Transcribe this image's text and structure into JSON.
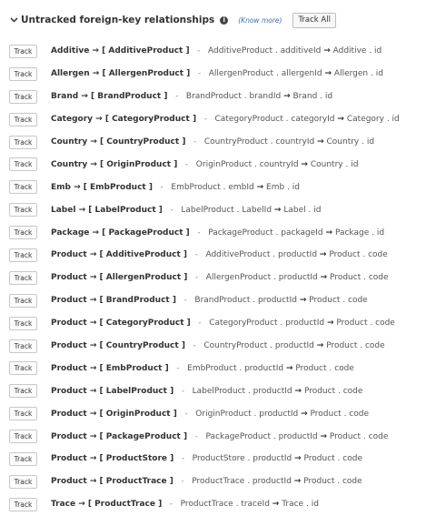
{
  "header": {
    "title": "Untracked foreign-key relationships",
    "know_more": "(Know more)",
    "track_all": "Track All"
  },
  "track_label": "Track",
  "rows": [
    {
      "source": "Additive",
      "target": "AdditiveProduct",
      "join_table": "AdditiveProduct",
      "join_col": "additiveId",
      "ref_table": "Additive",
      "ref_col": "id"
    },
    {
      "source": "Allergen",
      "target": "AllergenProduct",
      "join_table": "AllergenProduct",
      "join_col": "allergenId",
      "ref_table": "Allergen",
      "ref_col": "id"
    },
    {
      "source": "Brand",
      "target": "BrandProduct",
      "join_table": "BrandProduct",
      "join_col": "brandId",
      "ref_table": "Brand",
      "ref_col": "id"
    },
    {
      "source": "Category",
      "target": "CategoryProduct",
      "join_table": "CategoryProduct",
      "join_col": "categoryId",
      "ref_table": "Category",
      "ref_col": "id"
    },
    {
      "source": "Country",
      "target": "CountryProduct",
      "join_table": "CountryProduct",
      "join_col": "countryId",
      "ref_table": "Country",
      "ref_col": "id"
    },
    {
      "source": "Country",
      "target": "OriginProduct",
      "join_table": "OriginProduct",
      "join_col": "countryId",
      "ref_table": "Country",
      "ref_col": "id"
    },
    {
      "source": "Emb",
      "target": "EmbProduct",
      "join_table": "EmbProduct",
      "join_col": "embId",
      "ref_table": "Emb",
      "ref_col": "id"
    },
    {
      "source": "Label",
      "target": "LabelProduct",
      "join_table": "LabelProduct",
      "join_col": "LabelId",
      "ref_table": "Label",
      "ref_col": "id"
    },
    {
      "source": "Package",
      "target": "PackageProduct",
      "join_table": "PackageProduct",
      "join_col": "packageId",
      "ref_table": "Package",
      "ref_col": "id"
    },
    {
      "source": "Product",
      "target": "AdditiveProduct",
      "join_table": "AdditiveProduct",
      "join_col": "productId",
      "ref_table": "Product",
      "ref_col": "code"
    },
    {
      "source": "Product",
      "target": "AllergenProduct",
      "join_table": "AllergenProduct",
      "join_col": "productId",
      "ref_table": "Product",
      "ref_col": "code"
    },
    {
      "source": "Product",
      "target": "BrandProduct",
      "join_table": "BrandProduct",
      "join_col": "productId",
      "ref_table": "Product",
      "ref_col": "code"
    },
    {
      "source": "Product",
      "target": "CategoryProduct",
      "join_table": "CategoryProduct",
      "join_col": "productId",
      "ref_table": "Product",
      "ref_col": "code"
    },
    {
      "source": "Product",
      "target": "CountryProduct",
      "join_table": "CountryProduct",
      "join_col": "productId",
      "ref_table": "Product",
      "ref_col": "code"
    },
    {
      "source": "Product",
      "target": "EmbProduct",
      "join_table": "EmbProduct",
      "join_col": "productId",
      "ref_table": "Product",
      "ref_col": "code"
    },
    {
      "source": "Product",
      "target": "LabelProduct",
      "join_table": "LabelProduct",
      "join_col": "productId",
      "ref_table": "Product",
      "ref_col": "code"
    },
    {
      "source": "Product",
      "target": "OriginProduct",
      "join_table": "OriginProduct",
      "join_col": "productId",
      "ref_table": "Product",
      "ref_col": "code"
    },
    {
      "source": "Product",
      "target": "PackageProduct",
      "join_table": "PackageProduct",
      "join_col": "productId",
      "ref_table": "Product",
      "ref_col": "code"
    },
    {
      "source": "Product",
      "target": "ProductStore",
      "join_table": "ProductStore",
      "join_col": "productId",
      "ref_table": "Product",
      "ref_col": "code"
    },
    {
      "source": "Product",
      "target": "ProductTrace",
      "join_table": "ProductTrace",
      "join_col": "productId",
      "ref_table": "Product",
      "ref_col": "code"
    },
    {
      "source": "Trace",
      "target": "ProductTrace",
      "join_table": "ProductTrace",
      "join_col": "traceId",
      "ref_table": "Trace",
      "ref_col": "id"
    }
  ]
}
